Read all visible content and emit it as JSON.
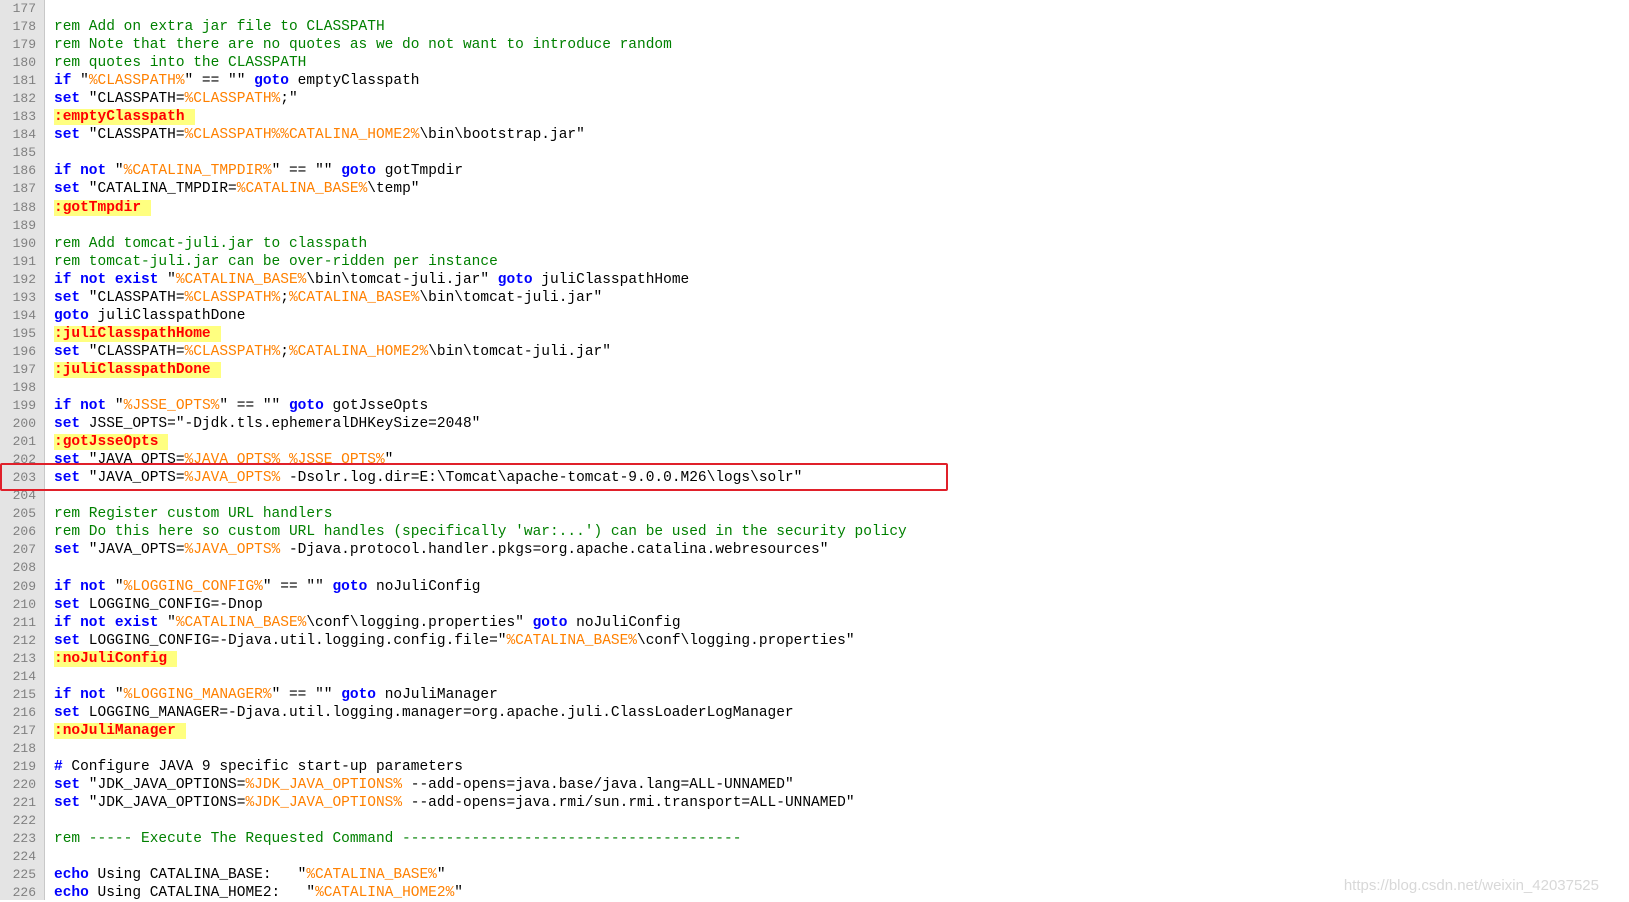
{
  "editor": {
    "lines": [
      {
        "n": "177",
        "t": []
      },
      {
        "n": "178",
        "t": [
          [
            "cm",
            "rem Add on extra jar file to CLASSPATH"
          ]
        ]
      },
      {
        "n": "179",
        "t": [
          [
            "cm",
            "rem Note that there are no quotes as we do not want to introduce random"
          ]
        ]
      },
      {
        "n": "180",
        "t": [
          [
            "cm",
            "rem quotes into the CLASSPATH"
          ]
        ]
      },
      {
        "n": "181",
        "t": [
          [
            "kw",
            "if"
          ],
          [
            "p",
            " \""
          ],
          [
            "var",
            "%CLASSPATH%"
          ],
          [
            "p",
            "\" == \"\" "
          ],
          [
            "kw",
            "goto"
          ],
          [
            "p",
            " emptyClasspath"
          ]
        ]
      },
      {
        "n": "182",
        "t": [
          [
            "kw",
            "set"
          ],
          [
            "p",
            " \"CLASSPATH="
          ],
          [
            "var",
            "%CLASSPATH%"
          ],
          [
            "p",
            ";\""
          ]
        ]
      },
      {
        "n": "183",
        "t": [
          [
            "lbl",
            ":emptyClasspath"
          ]
        ]
      },
      {
        "n": "184",
        "t": [
          [
            "kw",
            "set"
          ],
          [
            "p",
            " \"CLASSPATH="
          ],
          [
            "var",
            "%CLASSPATH%%CATALINA_HOME2%"
          ],
          [
            "p",
            "\\bin\\bootstrap.jar\""
          ]
        ]
      },
      {
        "n": "185",
        "t": []
      },
      {
        "n": "186",
        "t": [
          [
            "kw",
            "if not"
          ],
          [
            "p",
            " \""
          ],
          [
            "var",
            "%CATALINA_TMPDIR%"
          ],
          [
            "p",
            "\" == \"\" "
          ],
          [
            "kw",
            "goto"
          ],
          [
            "p",
            " gotTmpdir"
          ]
        ]
      },
      {
        "n": "187",
        "t": [
          [
            "kw",
            "set"
          ],
          [
            "p",
            " \"CATALINA_TMPDIR="
          ],
          [
            "var",
            "%CATALINA_BASE%"
          ],
          [
            "p",
            "\\temp\""
          ]
        ]
      },
      {
        "n": "188",
        "t": [
          [
            "lbl",
            ":gotTmpdir"
          ]
        ]
      },
      {
        "n": "189",
        "t": []
      },
      {
        "n": "190",
        "t": [
          [
            "cm",
            "rem Add tomcat-juli.jar to classpath"
          ]
        ]
      },
      {
        "n": "191",
        "t": [
          [
            "cm",
            "rem tomcat-juli.jar can be over-ridden per instance"
          ]
        ]
      },
      {
        "n": "192",
        "t": [
          [
            "kw",
            "if not exist"
          ],
          [
            "p",
            " \""
          ],
          [
            "var",
            "%CATALINA_BASE%"
          ],
          [
            "p",
            "\\bin\\tomcat-juli.jar\" "
          ],
          [
            "kw",
            "goto"
          ],
          [
            "p",
            " juliClasspathHome"
          ]
        ]
      },
      {
        "n": "193",
        "t": [
          [
            "kw",
            "set"
          ],
          [
            "p",
            " \"CLASSPATH="
          ],
          [
            "var",
            "%CLASSPATH%"
          ],
          [
            "p",
            ";"
          ],
          [
            "var",
            "%CATALINA_BASE%"
          ],
          [
            "p",
            "\\bin\\tomcat-juli.jar\""
          ]
        ]
      },
      {
        "n": "194",
        "t": [
          [
            "kw",
            "goto"
          ],
          [
            "p",
            " juliClasspathDone"
          ]
        ]
      },
      {
        "n": "195",
        "t": [
          [
            "lbl",
            ":juliClasspathHome"
          ]
        ]
      },
      {
        "n": "196",
        "t": [
          [
            "kw",
            "set"
          ],
          [
            "p",
            " \"CLASSPATH="
          ],
          [
            "var",
            "%CLASSPATH%"
          ],
          [
            "p",
            ";"
          ],
          [
            "var",
            "%CATALINA_HOME2%"
          ],
          [
            "p",
            "\\bin\\tomcat-juli.jar\""
          ]
        ]
      },
      {
        "n": "197",
        "t": [
          [
            "lbl",
            ":juliClasspathDone"
          ]
        ]
      },
      {
        "n": "198",
        "t": []
      },
      {
        "n": "199",
        "t": [
          [
            "kw",
            "if not"
          ],
          [
            "p",
            " \""
          ],
          [
            "var",
            "%JSSE_OPTS%"
          ],
          [
            "p",
            "\" == \"\" "
          ],
          [
            "kw",
            "goto"
          ],
          [
            "p",
            " gotJsseOpts"
          ]
        ]
      },
      {
        "n": "200",
        "t": [
          [
            "kw",
            "set"
          ],
          [
            "p",
            " JSSE_OPTS=\"-Djdk.tls.ephemeralDHKeySize=2048\""
          ]
        ]
      },
      {
        "n": "201",
        "t": [
          [
            "lbl",
            ":gotJsseOpts"
          ]
        ]
      },
      {
        "n": "202",
        "t": [
          [
            "kw",
            "set"
          ],
          [
            "p",
            " \"JAVA_OPTS="
          ],
          [
            "var",
            "%JAVA_OPTS% %JSSE_OPTS%"
          ],
          [
            "p",
            "\""
          ]
        ]
      },
      {
        "n": "203",
        "t": [
          [
            "kw",
            "set"
          ],
          [
            "p",
            " \"JAVA_OPTS="
          ],
          [
            "var",
            "%JAVA_OPTS%"
          ],
          [
            "p",
            " -Dsolr.log.dir=E:\\Tomcat\\apache-tomcat-9.0.0.M26\\logs\\solr\""
          ]
        ]
      },
      {
        "n": "204",
        "t": []
      },
      {
        "n": "205",
        "t": [
          [
            "cm",
            "rem Register custom URL handlers"
          ]
        ]
      },
      {
        "n": "206",
        "t": [
          [
            "cm",
            "rem Do this here so custom URL handles (specifically 'war:...') can be used in the security policy"
          ]
        ]
      },
      {
        "n": "207",
        "t": [
          [
            "kw",
            "set"
          ],
          [
            "p",
            " \"JAVA_OPTS="
          ],
          [
            "var",
            "%JAVA_OPTS%"
          ],
          [
            "p",
            " -Djava.protocol.handler.pkgs=org.apache.catalina.webresources\""
          ]
        ]
      },
      {
        "n": "208",
        "t": []
      },
      {
        "n": "209",
        "t": [
          [
            "kw",
            "if not"
          ],
          [
            "p",
            " \""
          ],
          [
            "var",
            "%LOGGING_CONFIG%"
          ],
          [
            "p",
            "\" == \"\" "
          ],
          [
            "kw",
            "goto"
          ],
          [
            "p",
            " noJuliConfig"
          ]
        ]
      },
      {
        "n": "210",
        "t": [
          [
            "kw",
            "set"
          ],
          [
            "p",
            " LOGGING_CONFIG=-Dnop"
          ]
        ]
      },
      {
        "n": "211",
        "t": [
          [
            "kw",
            "if not exist"
          ],
          [
            "p",
            " \""
          ],
          [
            "var",
            "%CATALINA_BASE%"
          ],
          [
            "p",
            "\\conf\\logging.properties\" "
          ],
          [
            "kw",
            "goto"
          ],
          [
            "p",
            " noJuliConfig"
          ]
        ]
      },
      {
        "n": "212",
        "t": [
          [
            "kw",
            "set"
          ],
          [
            "p",
            " LOGGING_CONFIG=-Djava.util.logging.config.file=\""
          ],
          [
            "var",
            "%CATALINA_BASE%"
          ],
          [
            "p",
            "\\conf\\logging.properties\""
          ]
        ]
      },
      {
        "n": "213",
        "t": [
          [
            "lbl",
            ":noJuliConfig"
          ]
        ]
      },
      {
        "n": "214",
        "t": []
      },
      {
        "n": "215",
        "t": [
          [
            "kw",
            "if not"
          ],
          [
            "p",
            " \""
          ],
          [
            "var",
            "%LOGGING_MANAGER%"
          ],
          [
            "p",
            "\" == \"\" "
          ],
          [
            "kw",
            "goto"
          ],
          [
            "p",
            " noJuliManager"
          ]
        ]
      },
      {
        "n": "216",
        "t": [
          [
            "kw",
            "set"
          ],
          [
            "p",
            " LOGGING_MANAGER=-Djava.util.logging.manager=org.apache.juli.ClassLoaderLogManager"
          ]
        ]
      },
      {
        "n": "217",
        "t": [
          [
            "lbl",
            ":noJuliManager"
          ]
        ]
      },
      {
        "n": "218",
        "t": []
      },
      {
        "n": "219",
        "t": [
          [
            "kw",
            "#"
          ],
          [
            "p",
            " Configure JAVA 9 specific start-up parameters"
          ]
        ]
      },
      {
        "n": "220",
        "t": [
          [
            "kw",
            "set"
          ],
          [
            "p",
            " \"JDK_JAVA_OPTIONS="
          ],
          [
            "var",
            "%JDK_JAVA_OPTIONS%"
          ],
          [
            "p",
            " --add-opens=java.base/java.lang=ALL-UNNAMED\""
          ]
        ]
      },
      {
        "n": "221",
        "t": [
          [
            "kw",
            "set"
          ],
          [
            "p",
            " \"JDK_JAVA_OPTIONS="
          ],
          [
            "var",
            "%JDK_JAVA_OPTIONS%"
          ],
          [
            "p",
            " --add-opens=java.rmi/sun.rmi.transport=ALL-UNNAMED\""
          ]
        ]
      },
      {
        "n": "222",
        "t": []
      },
      {
        "n": "223",
        "t": [
          [
            "cm",
            "rem ----- Execute The Requested Command ---------------------------------------"
          ]
        ]
      },
      {
        "n": "224",
        "t": []
      },
      {
        "n": "225",
        "t": [
          [
            "kw",
            "echo"
          ],
          [
            "p",
            " Using CATALINA_BASE:   \""
          ],
          [
            "var",
            "%CATALINA_BASE%"
          ],
          [
            "p",
            "\""
          ]
        ]
      },
      {
        "n": "226",
        "t": [
          [
            "kw",
            "echo"
          ],
          [
            "p",
            " Using CATALINA_HOME2:   \""
          ],
          [
            "var",
            "%CATALINA_HOME2%"
          ],
          [
            "p",
            "\""
          ]
        ]
      }
    ]
  },
  "watermark": "https://blog.csdn.net/weixin_42037525",
  "colors": {
    "keyword": "#0000ff",
    "comment": "#008000",
    "variable": "#ff8000",
    "label_bg": "#ffff80",
    "label_fg": "#ff0000",
    "highlight_box": "#e0202a"
  }
}
